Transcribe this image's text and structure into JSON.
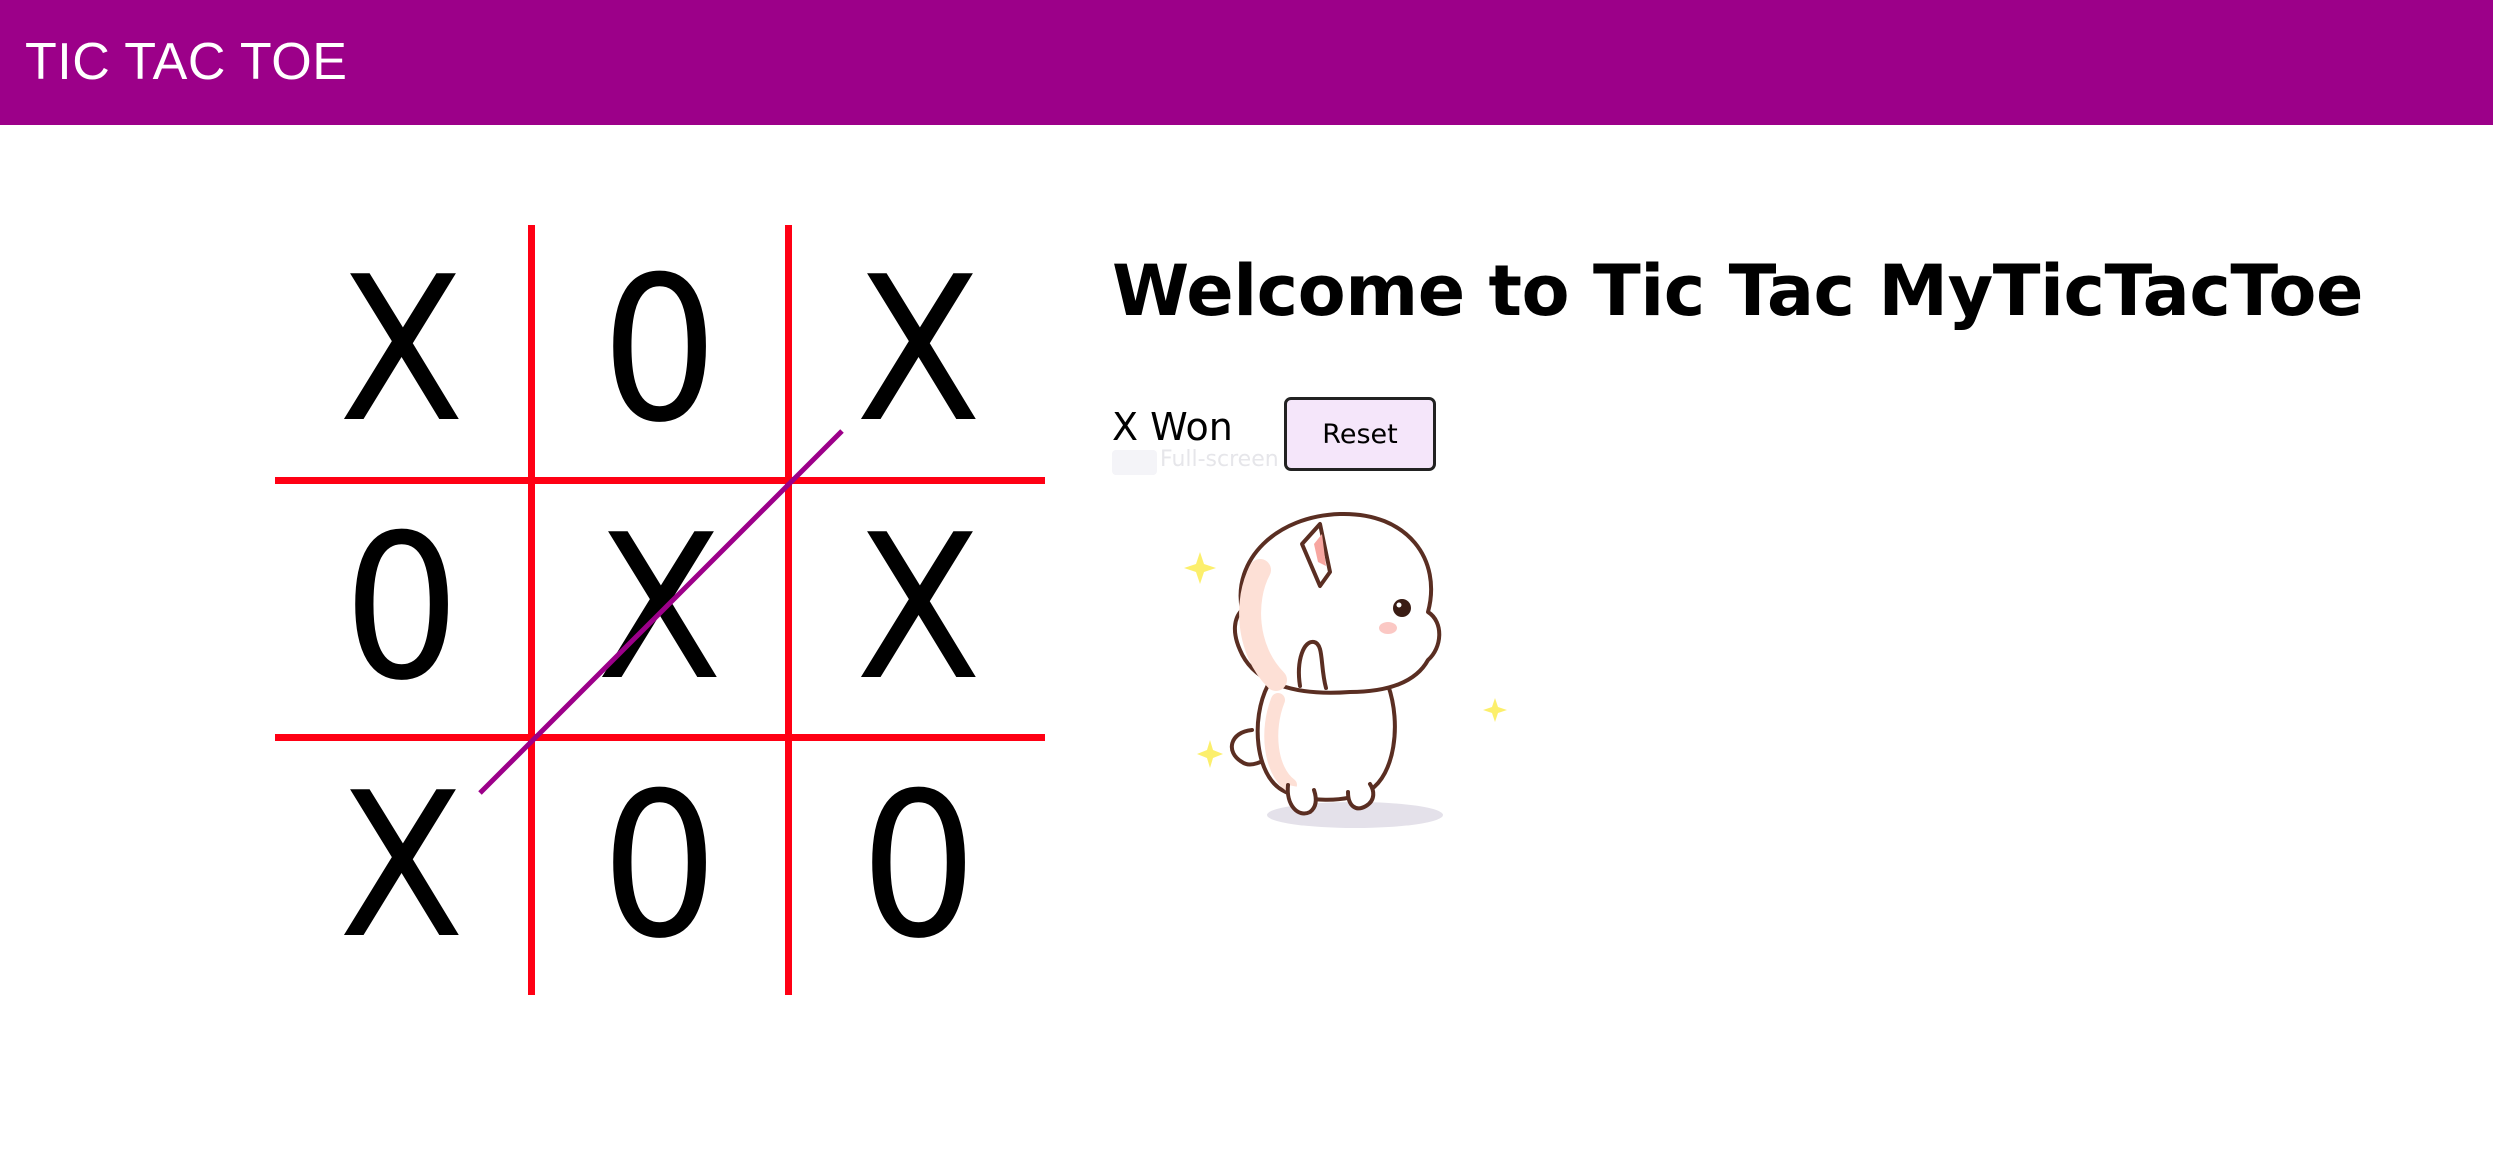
{
  "navbar": {
    "title": "TIC TAC TOE",
    "color": "#9c0089"
  },
  "game": {
    "heading": "Welcome to Tic Tac MyTicTacToe",
    "status": "X Won",
    "reset_label": "Reset",
    "overlay_hint": "Full-screen",
    "grid_color": "#ff0014",
    "win_line_color": "#9c0089",
    "winning_cells": [
      6,
      4,
      2
    ],
    "board": [
      [
        "X",
        "0",
        "X"
      ],
      [
        "0",
        "X",
        "X"
      ],
      [
        "X",
        "0",
        "0"
      ]
    ]
  },
  "mascot": {
    "icon": "cute-cat-sticker-icon"
  }
}
